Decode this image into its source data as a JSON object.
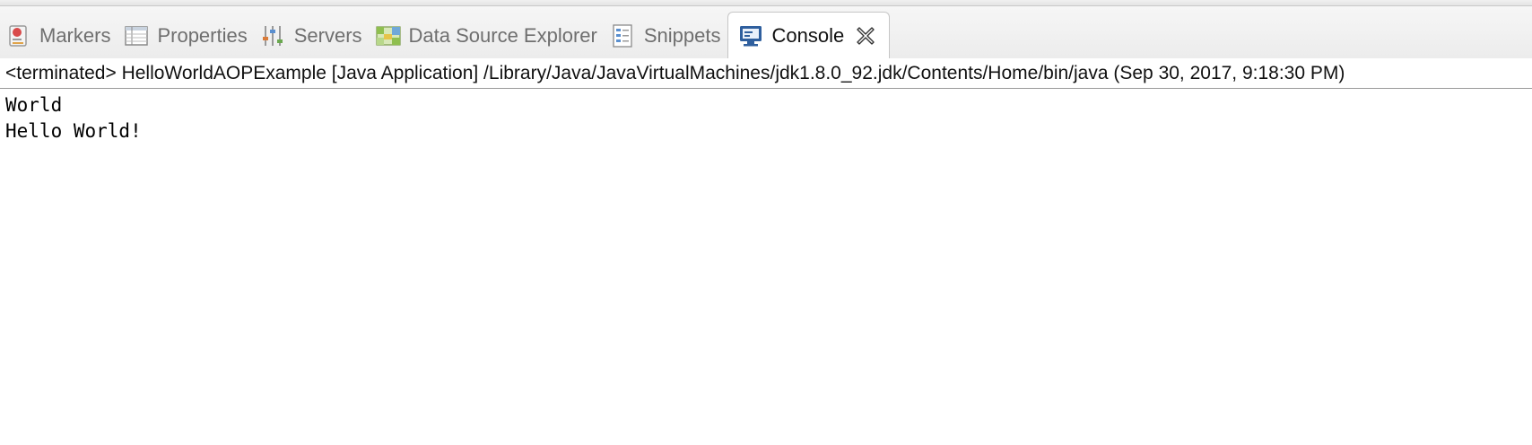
{
  "tabs": [
    {
      "label": "Markers",
      "icon": "markers-icon"
    },
    {
      "label": "Properties",
      "icon": "properties-icon"
    },
    {
      "label": "Servers",
      "icon": "servers-icon"
    },
    {
      "label": "Data Source Explorer",
      "icon": "data-source-explorer-icon"
    },
    {
      "label": "Snippets",
      "icon": "snippets-icon"
    },
    {
      "label": "Console",
      "icon": "console-icon",
      "active": true
    }
  ],
  "console": {
    "status": "<terminated> HelloWorldAOPExample [Java Application] /Library/Java/JavaVirtualMachines/jdk1.8.0_92.jdk/Contents/Home/bin/java (Sep 30, 2017, 9:18:30 PM)",
    "lines": [
      "World",
      "Hello World!"
    ]
  },
  "colors": {
    "active_text": "#111111",
    "inactive_text": "#6f6f6f",
    "console_icon_blue": "#2f5f9e"
  }
}
